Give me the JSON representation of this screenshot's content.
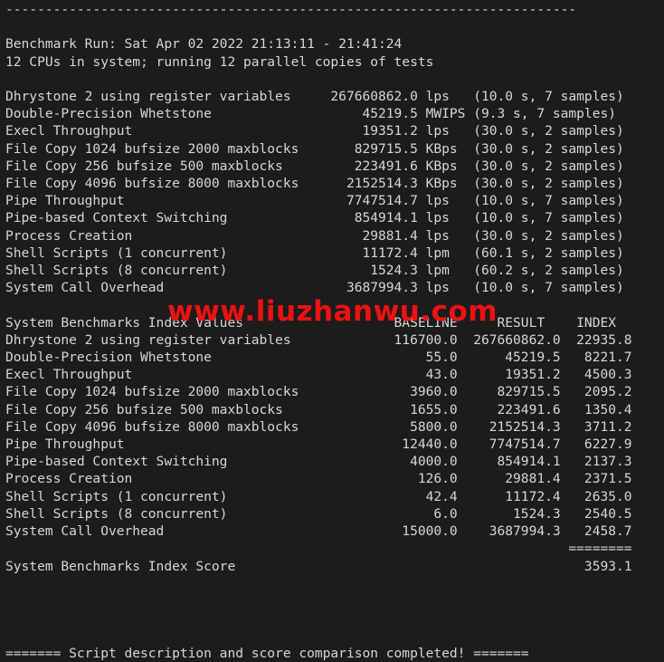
{
  "terminal": {
    "background_color": "#1c1c1c",
    "text_color": "#d6d6d6",
    "watermark": {
      "text": "www.liuzhanwu.com",
      "color": "#ee1111"
    },
    "rule_top": "------------------------------------------------------------------------",
    "header": {
      "run_line": "Benchmark Run: Sat Apr 02 2022 21:13:11 - 21:41:24",
      "cpu_line": "12 CPUs in system; running 12 parallel copies of tests"
    },
    "results": {
      "rows": [
        {
          "name": "Dhrystone 2 using register variables",
          "value": "267660862.0",
          "unit": "lps",
          "timing": "(10.0 s, 7 samples)"
        },
        {
          "name": "Double-Precision Whetstone",
          "value": "45219.5",
          "unit": "MWIPS",
          "timing": "(9.3 s, 7 samples)"
        },
        {
          "name": "Execl Throughput",
          "value": "19351.2",
          "unit": "lps",
          "timing": "(30.0 s, 2 samples)"
        },
        {
          "name": "File Copy 1024 bufsize 2000 maxblocks",
          "value": "829715.5",
          "unit": "KBps",
          "timing": "(30.0 s, 2 samples)"
        },
        {
          "name": "File Copy 256 bufsize 500 maxblocks",
          "value": "223491.6",
          "unit": "KBps",
          "timing": "(30.0 s, 2 samples)"
        },
        {
          "name": "File Copy 4096 bufsize 8000 maxblocks",
          "value": "2152514.3",
          "unit": "KBps",
          "timing": "(30.0 s, 2 samples)"
        },
        {
          "name": "Pipe Throughput",
          "value": "7747514.7",
          "unit": "lps",
          "timing": "(10.0 s, 7 samples)"
        },
        {
          "name": "Pipe-based Context Switching",
          "value": "854914.1",
          "unit": "lps",
          "timing": "(10.0 s, 7 samples)"
        },
        {
          "name": "Process Creation",
          "value": "29881.4",
          "unit": "lps",
          "timing": "(30.0 s, 2 samples)"
        },
        {
          "name": "Shell Scripts (1 concurrent)",
          "value": "11172.4",
          "unit": "lpm",
          "timing": "(60.1 s, 2 samples)"
        },
        {
          "name": "Shell Scripts (8 concurrent)",
          "value": "1524.3",
          "unit": "lpm",
          "timing": "(60.2 s, 2 samples)"
        },
        {
          "name": "System Call Overhead",
          "value": "3687994.3",
          "unit": "lps",
          "timing": "(10.0 s, 7 samples)"
        }
      ]
    },
    "index_table": {
      "title": "System Benchmarks Index Values",
      "columns": [
        "BASELINE",
        "RESULT",
        "INDEX"
      ],
      "rows": [
        {
          "name": "Dhrystone 2 using register variables",
          "baseline": "116700.0",
          "result": "267660862.0",
          "index": "22935.8"
        },
        {
          "name": "Double-Precision Whetstone",
          "baseline": "55.0",
          "result": "45219.5",
          "index": "8221.7"
        },
        {
          "name": "Execl Throughput",
          "baseline": "43.0",
          "result": "19351.2",
          "index": "4500.3"
        },
        {
          "name": "File Copy 1024 bufsize 2000 maxblocks",
          "baseline": "3960.0",
          "result": "829715.5",
          "index": "2095.2"
        },
        {
          "name": "File Copy 256 bufsize 500 maxblocks",
          "baseline": "1655.0",
          "result": "223491.6",
          "index": "1350.4"
        },
        {
          "name": "File Copy 4096 bufsize 8000 maxblocks",
          "baseline": "5800.0",
          "result": "2152514.3",
          "index": "3711.2"
        },
        {
          "name": "Pipe Throughput",
          "baseline": "12440.0",
          "result": "7747514.7",
          "index": "6227.9"
        },
        {
          "name": "Pipe-based Context Switching",
          "baseline": "4000.0",
          "result": "854914.1",
          "index": "2137.3"
        },
        {
          "name": "Process Creation",
          "baseline": "126.0",
          "result": "29881.4",
          "index": "2371.5"
        },
        {
          "name": "Shell Scripts (1 concurrent)",
          "baseline": "42.4",
          "result": "11172.4",
          "index": "2635.0"
        },
        {
          "name": "Shell Scripts (8 concurrent)",
          "baseline": "6.0",
          "result": "1524.3",
          "index": "2540.5"
        },
        {
          "name": "System Call Overhead",
          "baseline": "15000.0",
          "result": "3687994.3",
          "index": "2458.7"
        }
      ],
      "separator": "========",
      "score_label": "System Benchmarks Index Score",
      "score_value": "3593.1"
    },
    "footer": {
      "text": "======= Script description and score comparison completed! ======="
    }
  }
}
